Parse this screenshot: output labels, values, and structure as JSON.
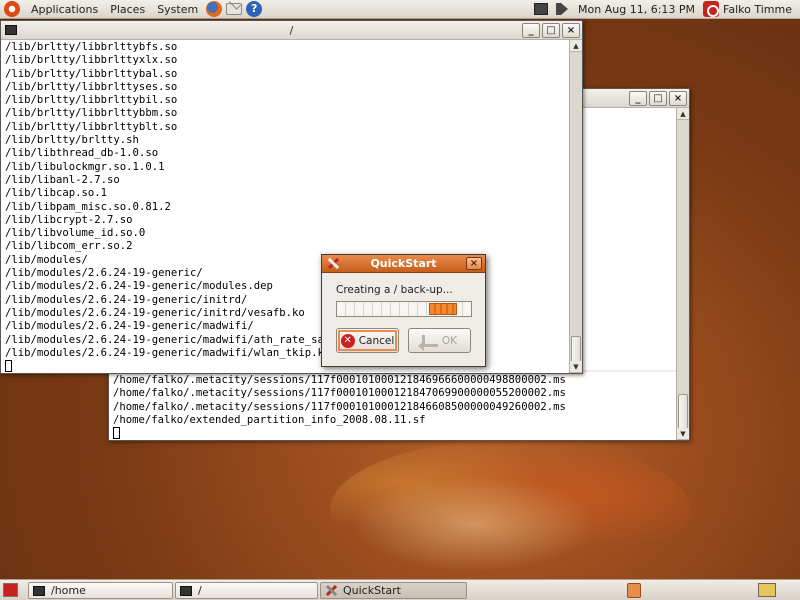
{
  "top_panel": {
    "menus": [
      "Applications",
      "Places",
      "System"
    ],
    "launchers": [
      "firefox-icon",
      "mail-icon",
      "help-icon"
    ],
    "help_glyph": "?",
    "clock": "Mon Aug 11,  6:13 PM",
    "user": "Falko Timme"
  },
  "window_controls": {
    "minimize": "_",
    "maximize": "□",
    "close": "×"
  },
  "terminal_front": {
    "title": "/",
    "lines": [
      "/lib/brltty/libbrlttybfs.so",
      "/lib/brltty/libbrlttyxlx.so",
      "/lib/brltty/libbrlttybal.so",
      "/lib/brltty/libbrlttyses.so",
      "/lib/brltty/libbrlttybil.so",
      "/lib/brltty/libbrlttybbm.so",
      "/lib/brltty/libbrlttyblt.so",
      "/lib/brltty/brltty.sh",
      "/lib/libthread_db-1.0.so",
      "/lib/libulockmgr.so.1.0.1",
      "/lib/libanl-2.7.so",
      "/lib/libcap.so.1",
      "/lib/libpam_misc.so.0.81.2",
      "/lib/libcrypt-2.7.so",
      "/lib/libvolume_id.so.0",
      "/lib/libcom_err.so.2",
      "/lib/modules/",
      "/lib/modules/2.6.24-19-generic/",
      "/lib/modules/2.6.24-19-generic/modules.dep",
      "/lib/modules/2.6.24-19-generic/initrd/",
      "/lib/modules/2.6.24-19-generic/initrd/vesafb.ko",
      "/lib/modules/2.6.24-19-generic/madwifi/",
      "/lib/modules/2.6.24-19-generic/madwifi/ath_rate_sam",
      "/lib/modules/2.6.24-19-generic/madwifi/wlan_tkip.ko"
    ]
  },
  "terminal_back": {
    "title": "",
    "lines": [
      "/home/falko/.metacity/sessions/117f000101000121846966600000498800002.ms",
      "/home/falko/.metacity/sessions/117f000101000121847069900000055200002.ms",
      "/home/falko/.metacity/sessions/117f000101000121846608500000049260002.ms",
      "/home/falko/extended_partition_info_2008.08.11.sf"
    ]
  },
  "dialog": {
    "title": "QuickStart",
    "message": "Creating a / back-up...",
    "cancel_label": "Cancel",
    "cancel_glyph": "✕",
    "ok_label": "OK"
  },
  "taskbar": {
    "items": [
      {
        "label": "/home",
        "icon": "terminal-icon"
      },
      {
        "label": "/",
        "icon": "terminal-icon"
      },
      {
        "label": "QuickStart",
        "icon": "quickstart-icon"
      }
    ]
  },
  "colors": {
    "accent": "#e98b4a",
    "wallpaper": "#7a3a14"
  }
}
